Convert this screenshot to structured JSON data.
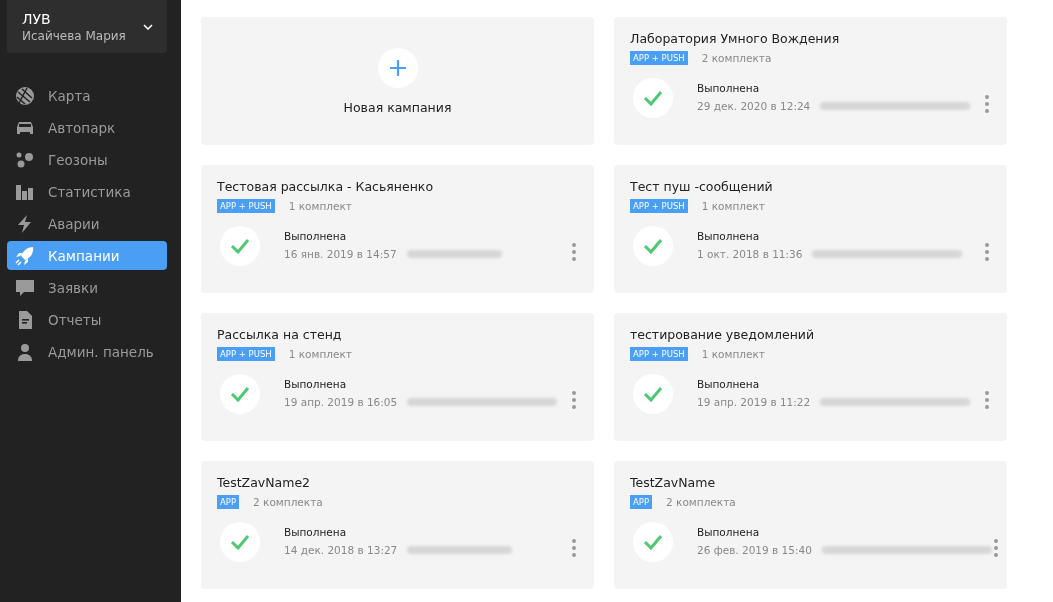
{
  "account": {
    "org": "ЛУВ",
    "user": "Исайчева Мария"
  },
  "nav": [
    {
      "label": "Карта",
      "selected": false
    },
    {
      "label": "Автопарк",
      "selected": false
    },
    {
      "label": "Геозоны",
      "selected": false
    },
    {
      "label": "Статистика",
      "selected": false
    },
    {
      "label": "Аварии",
      "selected": false
    },
    {
      "label": "Кампании",
      "selected": true
    },
    {
      "label": "Заявки",
      "selected": false
    },
    {
      "label": "Отчеты",
      "selected": false
    },
    {
      "label": "Админ. панель",
      "selected": false
    }
  ],
  "cards": [
    {
      "kind": "new",
      "label": "Новая кампания"
    },
    {
      "kind": "campaign",
      "title": "Лаборатория Умного Вождения",
      "channel": "APP + PUSH",
      "sets": "2 комплекта",
      "status": "Выполнена",
      "date": "29 дек. 2020 в 12:24",
      "author_hidden": true
    },
    {
      "kind": "campaign",
      "title": "Тестовая рассылка - Касьяненко",
      "channel": "APP + PUSH",
      "sets": "1 комплект",
      "status": "Выполнена",
      "date": "16 янв. 2019 в 14:57",
      "author_hidden": true
    },
    {
      "kind": "campaign",
      "title": "Тест пуш -сообщений",
      "channel": "APP + PUSH",
      "sets": "1 комплект",
      "status": "Выполнена",
      "date": "1 окт. 2018 в 11:36",
      "author_hidden": true
    },
    {
      "kind": "campaign",
      "title": "Рассылка на стенд",
      "channel": "APP + PUSH",
      "sets": "1 комплект",
      "status": "Выполнена",
      "date": "19 апр. 2019 в 16:05",
      "author_hidden": true
    },
    {
      "kind": "campaign",
      "title": "тестирование уведомлений",
      "channel": "APP + PUSH",
      "sets": "1 комплект",
      "status": "Выполнена",
      "date": "19 апр. 2019 в 11:22",
      "author_hidden": true
    },
    {
      "kind": "campaign",
      "title": "TestZavName2",
      "channel": "APP",
      "sets": "2 комплекта",
      "status": "Выполнена",
      "date": "14 дек. 2018 в 13:27",
      "author_hidden": true
    },
    {
      "kind": "campaign",
      "title": "TestZavName",
      "channel": "APP",
      "sets": "2 комплекта",
      "status": "Выполнена",
      "date": "26 фев. 2019 в 15:40",
      "author_hidden": true
    }
  ]
}
